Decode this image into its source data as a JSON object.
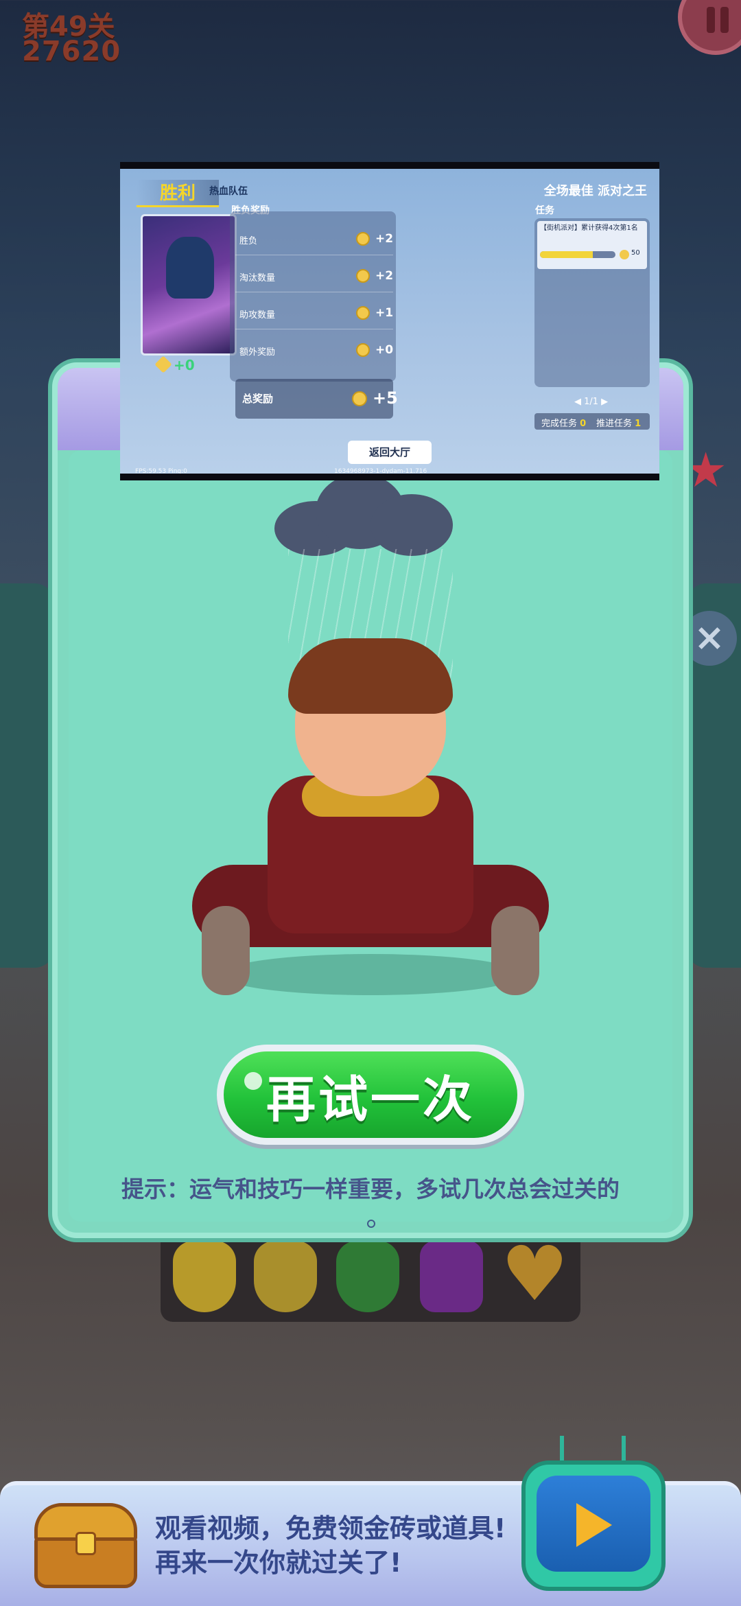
{
  "hud": {
    "level": "第49关",
    "score": "27620"
  },
  "victory": {
    "title": "胜利",
    "team_label": "热血队伍",
    "best_label": "全场最佳  派对之王",
    "gems": "+0",
    "rewards_heading": "胜负奖励",
    "rewards": [
      {
        "label": "胜负",
        "value": "+2"
      },
      {
        "label": "淘汰数量",
        "value": "+2"
      },
      {
        "label": "助攻数量",
        "value": "+1"
      },
      {
        "label": "额外奖励",
        "value": "+0"
      }
    ],
    "total": {
      "label": "总奖励",
      "value": "+5"
    },
    "tasks_heading": "任务",
    "task": {
      "text": "【街机派对】累计获得4次第1名",
      "reward": "50",
      "progress": 0.7
    },
    "task_pager": "◀  1/1  ▶",
    "task_done_label": "完成任务",
    "task_done_count": "0",
    "task_push_label": "推进任务",
    "task_push_count": "1",
    "lobby_button": "返回大厅",
    "debug_fps": "FPS:59.53 Ping:0",
    "debug_id": "1634968973-1-dydam-11.716"
  },
  "popup": {
    "retry_label": "再试一次",
    "tip": "提示：运气和技巧一样重要，多试几次总会过关的"
  },
  "ad_banner": {
    "line1": "观看视频，免费领金砖或道具!",
    "line2": "再来一次你就过关了!"
  },
  "colors": {
    "popup_bg": "#7fd9c0",
    "retry_green": "#22c23a",
    "victory_gold": "#f5d52a",
    "ad_text": "#34478a"
  },
  "icons": [
    "pause-icon",
    "close-icon",
    "star-icon",
    "coin-icon",
    "gem-icon",
    "chest-icon",
    "play-icon",
    "tv-icon",
    "info-icon"
  ]
}
